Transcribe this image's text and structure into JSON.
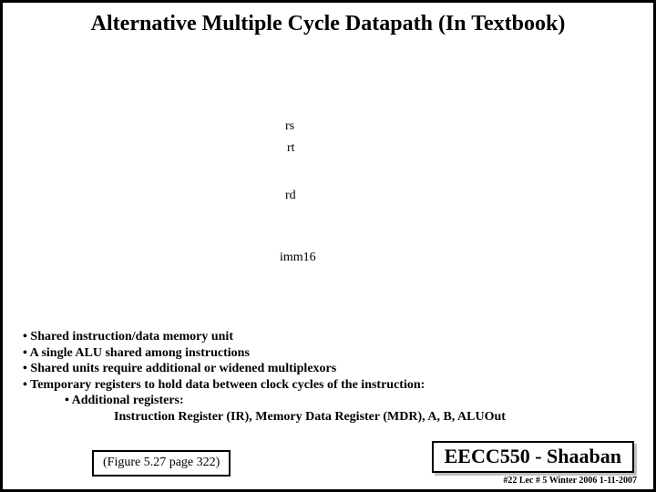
{
  "title": "Alternative Multiple Cycle Datapath (In Textbook)",
  "fields": {
    "rs": "rs",
    "rt": "rt",
    "rd": "rd",
    "imm16": "imm16"
  },
  "bullets": {
    "b1": "•  Shared instruction/data memory unit",
    "b2": "•  A single ALU shared among instructions",
    "b3": "•  Shared units require additional or widened multiplexors",
    "b4": "•  Temporary registers to hold data between clock cycles of the instruction:",
    "b4a": "•  Additional registers:",
    "b4b": "Instruction Register (IR),   Memory Data Register (MDR),   A,  B,   ALUOut"
  },
  "figref": "(Figure 5.27 page 322)",
  "course": "EECC550 - Shaaban",
  "footer": "#22   Lec # 5  Winter 2006  1-11-2007"
}
